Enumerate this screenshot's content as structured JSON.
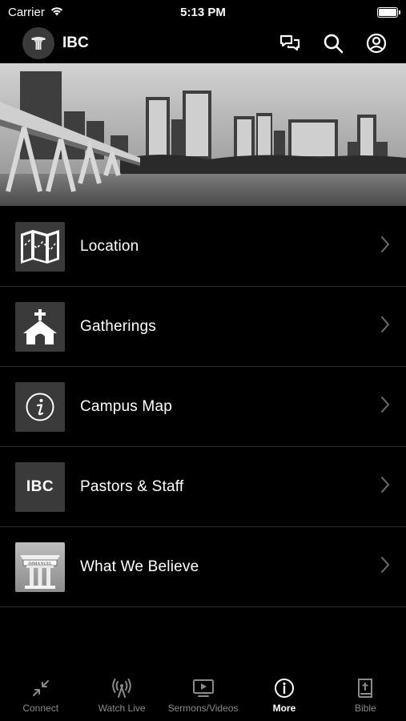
{
  "status_bar": {
    "carrier": "Carrier",
    "time": "5:13 PM",
    "icons": [
      "wifi-icon",
      "battery-icon"
    ]
  },
  "header": {
    "title": "IBC",
    "logo": "church-pillar-logo",
    "icons": [
      "chat-icon",
      "search-icon",
      "profile-icon"
    ]
  },
  "hero": {
    "image": "city-skyline-bridge-photo"
  },
  "menu": {
    "items": [
      {
        "label": "Location",
        "icon": "map-icon"
      },
      {
        "label": "Gatherings",
        "icon": "church-icon"
      },
      {
        "label": "Campus Map",
        "icon": "info-icon"
      },
      {
        "label": "Pastors & Staff",
        "icon": "ibc-logo-tile",
        "icon_text": "IBC"
      },
      {
        "label": "What We Believe",
        "icon": "building-icon",
        "icon_text": "IMMANUEL"
      }
    ]
  },
  "tab_bar": {
    "active": "More",
    "tabs": [
      {
        "label": "Connect",
        "icon": "connect-icon"
      },
      {
        "label": "Watch Live",
        "icon": "broadcast-icon"
      },
      {
        "label": "Sermons/Videos",
        "icon": "tv-play-icon"
      },
      {
        "label": "More",
        "icon": "info-circle-icon"
      },
      {
        "label": "Bible",
        "icon": "bible-icon"
      }
    ]
  },
  "colors": {
    "background": "#000000",
    "tile": "#3a3a3a",
    "divider": "#2c2c2c",
    "tab_inactive": "#8a8a8a",
    "tab_active": "#ffffff"
  }
}
